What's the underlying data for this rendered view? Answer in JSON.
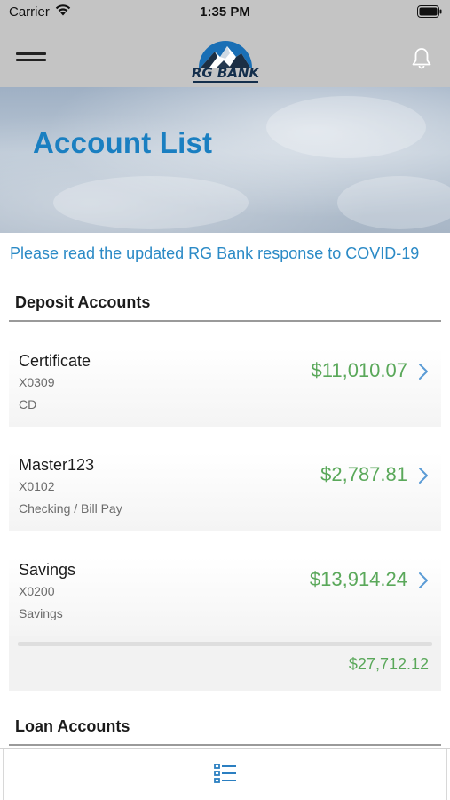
{
  "status_bar": {
    "carrier": "Carrier",
    "time": "1:35 PM"
  },
  "header": {
    "logo_text": "RG BANK",
    "menu_icon": "hamburger-icon",
    "notification_icon": "bell-icon"
  },
  "hero": {
    "title": "Account List"
  },
  "notice": {
    "text": "Please read the updated RG Bank response to COVID-19"
  },
  "sections": {
    "deposit": {
      "title": "Deposit Accounts",
      "accounts": [
        {
          "name": "Certificate",
          "number": "X0309",
          "type": "CD",
          "balance": "$11,010.07"
        },
        {
          "name": "Master123",
          "number": "X0102",
          "type": "Checking / Bill Pay",
          "balance": "$2,787.81"
        },
        {
          "name": "Savings",
          "number": "X0200",
          "type": "Savings",
          "balance": "$13,914.24"
        }
      ],
      "total": "$27,712.12"
    },
    "loan": {
      "title": "Loan Accounts"
    }
  },
  "tab_bar": {
    "active_icon": "account-list-icon"
  },
  "colors": {
    "accent_blue": "#1a7fc1",
    "link_blue": "#2b8ac6",
    "balance_green": "#5aa85a",
    "header_gray": "#c4c4c4"
  }
}
